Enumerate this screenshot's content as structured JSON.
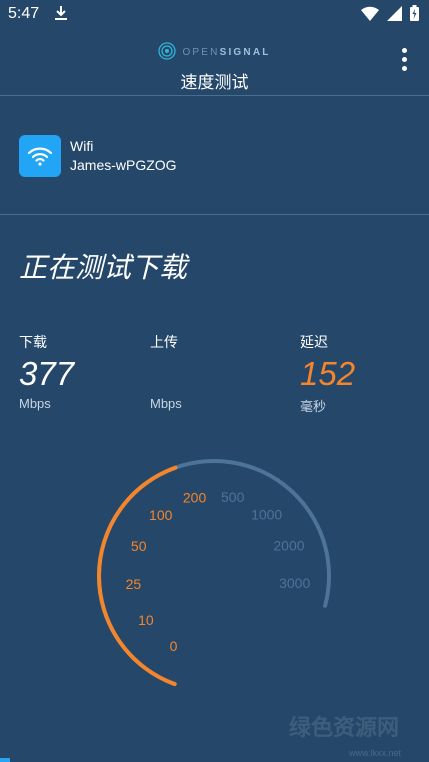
{
  "status_bar": {
    "time": "5:47"
  },
  "app_bar": {
    "brand_open": "OPEN",
    "brand_signal": "SIGNAL",
    "title": "速度测试"
  },
  "network": {
    "type": "Wifi",
    "ssid": "James-wPGZOG"
  },
  "test_status": "正在测试下载",
  "metrics": {
    "download": {
      "label": "下载",
      "value": "377",
      "unit": "Mbps"
    },
    "upload": {
      "label": "上传",
      "value": "",
      "unit": "Mbps"
    },
    "latency": {
      "label": "延迟",
      "value": "152",
      "unit": "毫秒"
    }
  },
  "gauge": {
    "labels": [
      "0",
      "10",
      "25",
      "50",
      "100",
      "200",
      "500",
      "1000",
      "2000",
      "3000"
    ],
    "active_label_count": 6,
    "progress_fraction": 0.53
  },
  "watermark": {
    "text": "绿色资源网",
    "url": "www.lkxx.net"
  },
  "colors": {
    "background": "#24476a",
    "accent": "#f5852a",
    "inactive": "#4d7396",
    "wifi_tile": "#21a5f4"
  }
}
